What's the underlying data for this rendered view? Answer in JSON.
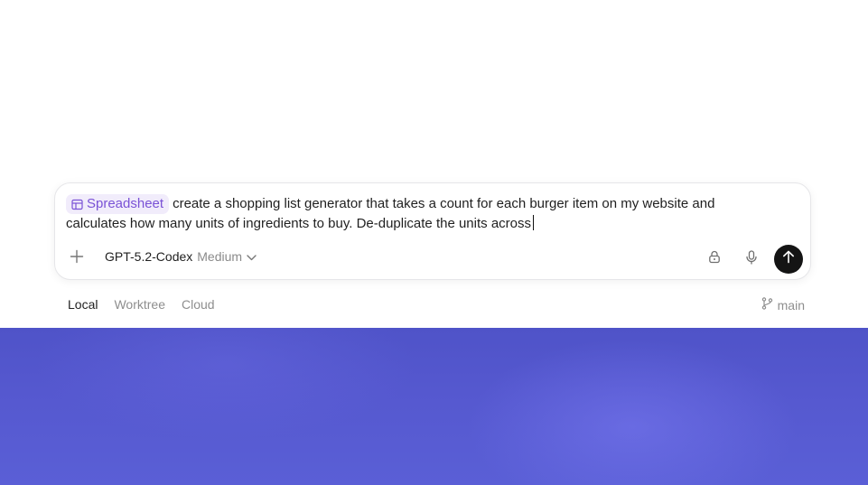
{
  "composer": {
    "chip_label": "Spreadsheet",
    "prompt_text": "create a shopping list generator that takes a count for each burger item on my website and calculates how many units of ingredients to buy. De-duplicate the units across",
    "model_name": "GPT-5.2-Codex",
    "model_effort": "Medium",
    "icons": {
      "chip": "table-icon",
      "add": "plus-icon",
      "dropdown": "chevron-down-icon",
      "permissions": "lock-icon",
      "voice": "microphone-icon",
      "send": "arrow-up-icon"
    }
  },
  "environment_tabs": [
    {
      "label": "Local",
      "active": true
    },
    {
      "label": "Worktree",
      "active": false
    },
    {
      "label": "Cloud",
      "active": false
    }
  ],
  "branch": {
    "label": "main",
    "icon": "git-branch-icon"
  },
  "colors": {
    "chip_background": "#f1ecfb",
    "chip_text": "#7a52d6",
    "send_button": "#141414",
    "backdrop_blue": "#5558cf"
  }
}
